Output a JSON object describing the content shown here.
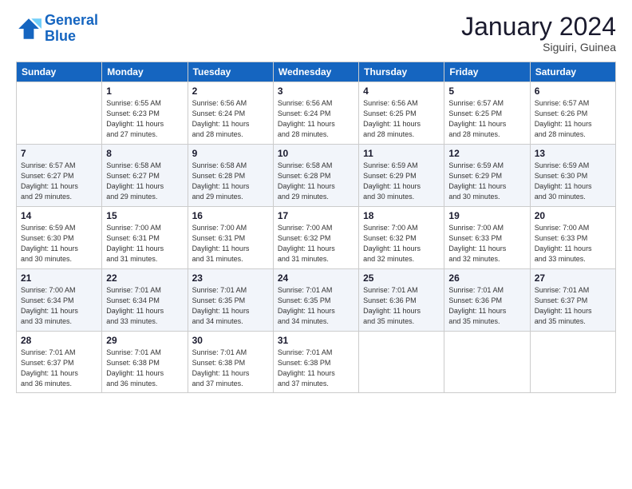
{
  "logo": {
    "line1": "General",
    "line2": "Blue"
  },
  "title": "January 2024",
  "location": "Siguiri, Guinea",
  "days_of_week": [
    "Sunday",
    "Monday",
    "Tuesday",
    "Wednesday",
    "Thursday",
    "Friday",
    "Saturday"
  ],
  "weeks": [
    [
      {
        "num": "",
        "sunrise": "",
        "sunset": "",
        "daylight": ""
      },
      {
        "num": "1",
        "sunrise": "Sunrise: 6:55 AM",
        "sunset": "Sunset: 6:23 PM",
        "daylight": "Daylight: 11 hours and 27 minutes."
      },
      {
        "num": "2",
        "sunrise": "Sunrise: 6:56 AM",
        "sunset": "Sunset: 6:24 PM",
        "daylight": "Daylight: 11 hours and 28 minutes."
      },
      {
        "num": "3",
        "sunrise": "Sunrise: 6:56 AM",
        "sunset": "Sunset: 6:24 PM",
        "daylight": "Daylight: 11 hours and 28 minutes."
      },
      {
        "num": "4",
        "sunrise": "Sunrise: 6:56 AM",
        "sunset": "Sunset: 6:25 PM",
        "daylight": "Daylight: 11 hours and 28 minutes."
      },
      {
        "num": "5",
        "sunrise": "Sunrise: 6:57 AM",
        "sunset": "Sunset: 6:25 PM",
        "daylight": "Daylight: 11 hours and 28 minutes."
      },
      {
        "num": "6",
        "sunrise": "Sunrise: 6:57 AM",
        "sunset": "Sunset: 6:26 PM",
        "daylight": "Daylight: 11 hours and 28 minutes."
      }
    ],
    [
      {
        "num": "7",
        "sunrise": "Sunrise: 6:57 AM",
        "sunset": "Sunset: 6:27 PM",
        "daylight": "Daylight: 11 hours and 29 minutes."
      },
      {
        "num": "8",
        "sunrise": "Sunrise: 6:58 AM",
        "sunset": "Sunset: 6:27 PM",
        "daylight": "Daylight: 11 hours and 29 minutes."
      },
      {
        "num": "9",
        "sunrise": "Sunrise: 6:58 AM",
        "sunset": "Sunset: 6:28 PM",
        "daylight": "Daylight: 11 hours and 29 minutes."
      },
      {
        "num": "10",
        "sunrise": "Sunrise: 6:58 AM",
        "sunset": "Sunset: 6:28 PM",
        "daylight": "Daylight: 11 hours and 29 minutes."
      },
      {
        "num": "11",
        "sunrise": "Sunrise: 6:59 AM",
        "sunset": "Sunset: 6:29 PM",
        "daylight": "Daylight: 11 hours and 30 minutes."
      },
      {
        "num": "12",
        "sunrise": "Sunrise: 6:59 AM",
        "sunset": "Sunset: 6:29 PM",
        "daylight": "Daylight: 11 hours and 30 minutes."
      },
      {
        "num": "13",
        "sunrise": "Sunrise: 6:59 AM",
        "sunset": "Sunset: 6:30 PM",
        "daylight": "Daylight: 11 hours and 30 minutes."
      }
    ],
    [
      {
        "num": "14",
        "sunrise": "Sunrise: 6:59 AM",
        "sunset": "Sunset: 6:30 PM",
        "daylight": "Daylight: 11 hours and 30 minutes."
      },
      {
        "num": "15",
        "sunrise": "Sunrise: 7:00 AM",
        "sunset": "Sunset: 6:31 PM",
        "daylight": "Daylight: 11 hours and 31 minutes."
      },
      {
        "num": "16",
        "sunrise": "Sunrise: 7:00 AM",
        "sunset": "Sunset: 6:31 PM",
        "daylight": "Daylight: 11 hours and 31 minutes."
      },
      {
        "num": "17",
        "sunrise": "Sunrise: 7:00 AM",
        "sunset": "Sunset: 6:32 PM",
        "daylight": "Daylight: 11 hours and 31 minutes."
      },
      {
        "num": "18",
        "sunrise": "Sunrise: 7:00 AM",
        "sunset": "Sunset: 6:32 PM",
        "daylight": "Daylight: 11 hours and 32 minutes."
      },
      {
        "num": "19",
        "sunrise": "Sunrise: 7:00 AM",
        "sunset": "Sunset: 6:33 PM",
        "daylight": "Daylight: 11 hours and 32 minutes."
      },
      {
        "num": "20",
        "sunrise": "Sunrise: 7:00 AM",
        "sunset": "Sunset: 6:33 PM",
        "daylight": "Daylight: 11 hours and 33 minutes."
      }
    ],
    [
      {
        "num": "21",
        "sunrise": "Sunrise: 7:00 AM",
        "sunset": "Sunset: 6:34 PM",
        "daylight": "Daylight: 11 hours and 33 minutes."
      },
      {
        "num": "22",
        "sunrise": "Sunrise: 7:01 AM",
        "sunset": "Sunset: 6:34 PM",
        "daylight": "Daylight: 11 hours and 33 minutes."
      },
      {
        "num": "23",
        "sunrise": "Sunrise: 7:01 AM",
        "sunset": "Sunset: 6:35 PM",
        "daylight": "Daylight: 11 hours and 34 minutes."
      },
      {
        "num": "24",
        "sunrise": "Sunrise: 7:01 AM",
        "sunset": "Sunset: 6:35 PM",
        "daylight": "Daylight: 11 hours and 34 minutes."
      },
      {
        "num": "25",
        "sunrise": "Sunrise: 7:01 AM",
        "sunset": "Sunset: 6:36 PM",
        "daylight": "Daylight: 11 hours and 35 minutes."
      },
      {
        "num": "26",
        "sunrise": "Sunrise: 7:01 AM",
        "sunset": "Sunset: 6:36 PM",
        "daylight": "Daylight: 11 hours and 35 minutes."
      },
      {
        "num": "27",
        "sunrise": "Sunrise: 7:01 AM",
        "sunset": "Sunset: 6:37 PM",
        "daylight": "Daylight: 11 hours and 35 minutes."
      }
    ],
    [
      {
        "num": "28",
        "sunrise": "Sunrise: 7:01 AM",
        "sunset": "Sunset: 6:37 PM",
        "daylight": "Daylight: 11 hours and 36 minutes."
      },
      {
        "num": "29",
        "sunrise": "Sunrise: 7:01 AM",
        "sunset": "Sunset: 6:38 PM",
        "daylight": "Daylight: 11 hours and 36 minutes."
      },
      {
        "num": "30",
        "sunrise": "Sunrise: 7:01 AM",
        "sunset": "Sunset: 6:38 PM",
        "daylight": "Daylight: 11 hours and 37 minutes."
      },
      {
        "num": "31",
        "sunrise": "Sunrise: 7:01 AM",
        "sunset": "Sunset: 6:38 PM",
        "daylight": "Daylight: 11 hours and 37 minutes."
      },
      {
        "num": "",
        "sunrise": "",
        "sunset": "",
        "daylight": ""
      },
      {
        "num": "",
        "sunrise": "",
        "sunset": "",
        "daylight": ""
      },
      {
        "num": "",
        "sunrise": "",
        "sunset": "",
        "daylight": ""
      }
    ]
  ]
}
